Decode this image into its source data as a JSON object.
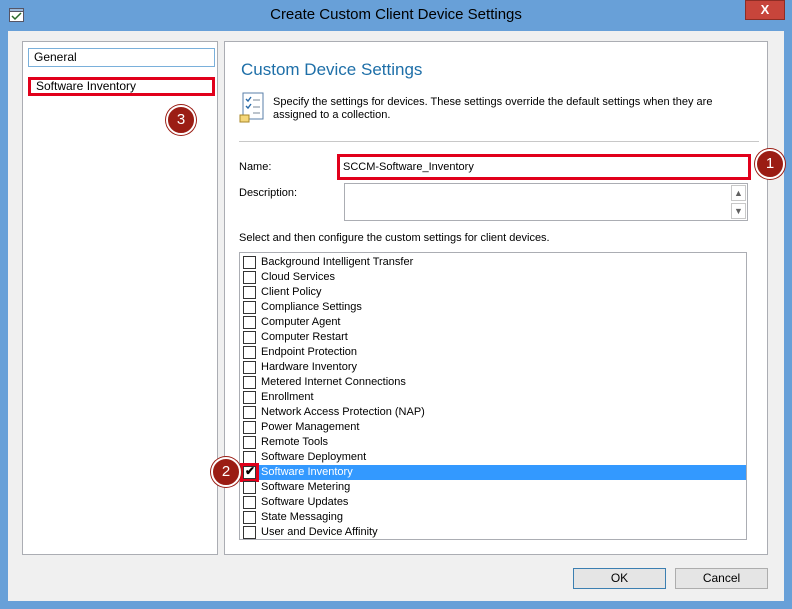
{
  "window": {
    "title": "Create Custom Client Device Settings",
    "close_label": "X"
  },
  "nav": {
    "items": [
      {
        "label": "General"
      },
      {
        "label": "Software Inventory"
      }
    ]
  },
  "main": {
    "heading": "Custom Device Settings",
    "description": "Specify the settings for devices. These settings override the default settings when they are assigned to a collection.",
    "name_label": "Name:",
    "name_value": "SCCM-Software_Inventory",
    "description_label": "Description:",
    "description_value": "",
    "instruction": "Select and then configure the custom settings for client devices.",
    "settings": [
      {
        "label": "Background Intelligent Transfer",
        "checked": false
      },
      {
        "label": "Cloud Services",
        "checked": false
      },
      {
        "label": "Client Policy",
        "checked": false
      },
      {
        "label": "Compliance Settings",
        "checked": false
      },
      {
        "label": "Computer Agent",
        "checked": false
      },
      {
        "label": "Computer Restart",
        "checked": false
      },
      {
        "label": "Endpoint Protection",
        "checked": false
      },
      {
        "label": "Hardware Inventory",
        "checked": false
      },
      {
        "label": "Metered Internet Connections",
        "checked": false
      },
      {
        "label": "Enrollment",
        "checked": false
      },
      {
        "label": "Network Access Protection (NAP)",
        "checked": false
      },
      {
        "label": "Power Management",
        "checked": false
      },
      {
        "label": "Remote Tools",
        "checked": false
      },
      {
        "label": "Software Deployment",
        "checked": false
      },
      {
        "label": "Software Inventory",
        "checked": true
      },
      {
        "label": "Software Metering",
        "checked": false
      },
      {
        "label": "Software Updates",
        "checked": false
      },
      {
        "label": "State Messaging",
        "checked": false
      },
      {
        "label": "User and Device Affinity",
        "checked": false
      }
    ]
  },
  "buttons": {
    "ok": "OK",
    "cancel": "Cancel"
  },
  "annotations": {
    "badge1": "1",
    "badge2": "2",
    "badge3": "3"
  },
  "colors": {
    "titlebar": "#68a0d8",
    "highlight": "#e1001b",
    "badge": "#9b1d14",
    "heading": "#1e6fa8",
    "selection": "#3399ff"
  }
}
